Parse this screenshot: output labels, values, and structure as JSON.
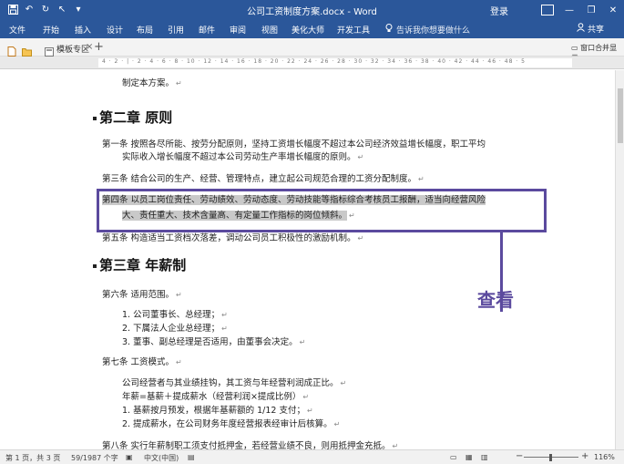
{
  "window": {
    "title": "公司工资制度方案.docx  -  Word",
    "login": "登录",
    "share": "共享"
  },
  "icons": {
    "save": "save-icon",
    "undo": "undo-icon",
    "redo": "redo-icon",
    "pointer": "pointer-icon",
    "customize": "customize-icon",
    "lightbulb": "lightbulb-icon",
    "person": "person-icon"
  },
  "ribbon_tabs": [
    "文件",
    "开始",
    "插入",
    "设计",
    "布局",
    "引用",
    "邮件",
    "审阅",
    "视图",
    "美化大师",
    "开发工具"
  ],
  "tell_me": "告诉我你想要做什么",
  "doc_tabs": {
    "template": "模板专区",
    "close": "×",
    "add": "+",
    "window_label": "窗口合并显示"
  },
  "ruler_numbers": "4 · 2 · | · 2 · 4 · 6 · 8 · 10 · 12 · 14 · 16 · 18 · 20 · 22 · 24 · 26 · 28 · 30 · 32 · 34 · 36 · 38 · 40 · 42 · 44 · 46 · 48 · 5",
  "document": {
    "line0": "制定本方案。",
    "heading2": "第二章    原则",
    "art1_a": "第一条    按照各尽所能、按劳分配原则，坚持工资增长幅度不超过本公司经济效益增长幅度，职工平均",
    "art1_b": "实际收入增长幅度不超过本公司劳动生产率增长幅度的原则。",
    "art3": "第三条    结合公司的生产、经营、管理特点，建立起公司规范合理的工资分配制度。",
    "art4_a": "第四条    以员工岗位责任、劳动绩效、劳动态度、劳动技能等指标综合考核员工报酬，适当向经营风险",
    "art4_b": "大、责任重大、技术含量高、有定量工作指标的岗位倾斜。",
    "art5": "第五条    构造适当工资档次落差，调动公司员工积极性的激励机制。",
    "heading3": "第三章    年薪制",
    "art6": "第六条    适用范围。",
    "art6_1": "1. 公司董事长、总经理；",
    "art6_2": "2. 下属法人企业总经理；",
    "art6_3": "3. 董事、副总经理是否适用，由董事会决定。",
    "art7": "第七条    工资模式。",
    "art7_a": "公司经营者与其业绩挂钩，其工资与年经营利润成正比。",
    "art7_b": "年薪=基薪＋提成薪水（经营利润×提成比例）",
    "art7_1": "1. 基薪按月预发，根据年基薪额的 1/12 支付；",
    "art7_2": "2. 提成薪水，在公司财务年度经营报表经审计后核算。",
    "art8": "第八条    实行年薪制职工须支付抵押金，若经营业绩不良，则用抵押金充抵。",
    "paragraph_mark": "↵"
  },
  "annotation": {
    "label": "查看",
    "color": "#5b4a9e"
  },
  "status": {
    "page": "第 1 页，共 3 页",
    "words": "59/1987 个字",
    "lang": "中文(中国)",
    "zoom": "116%",
    "zoom_minus": "−",
    "zoom_plus": "+"
  },
  "colors": {
    "ribbon": "#2b579a",
    "highlight": "#c9c9c9"
  }
}
